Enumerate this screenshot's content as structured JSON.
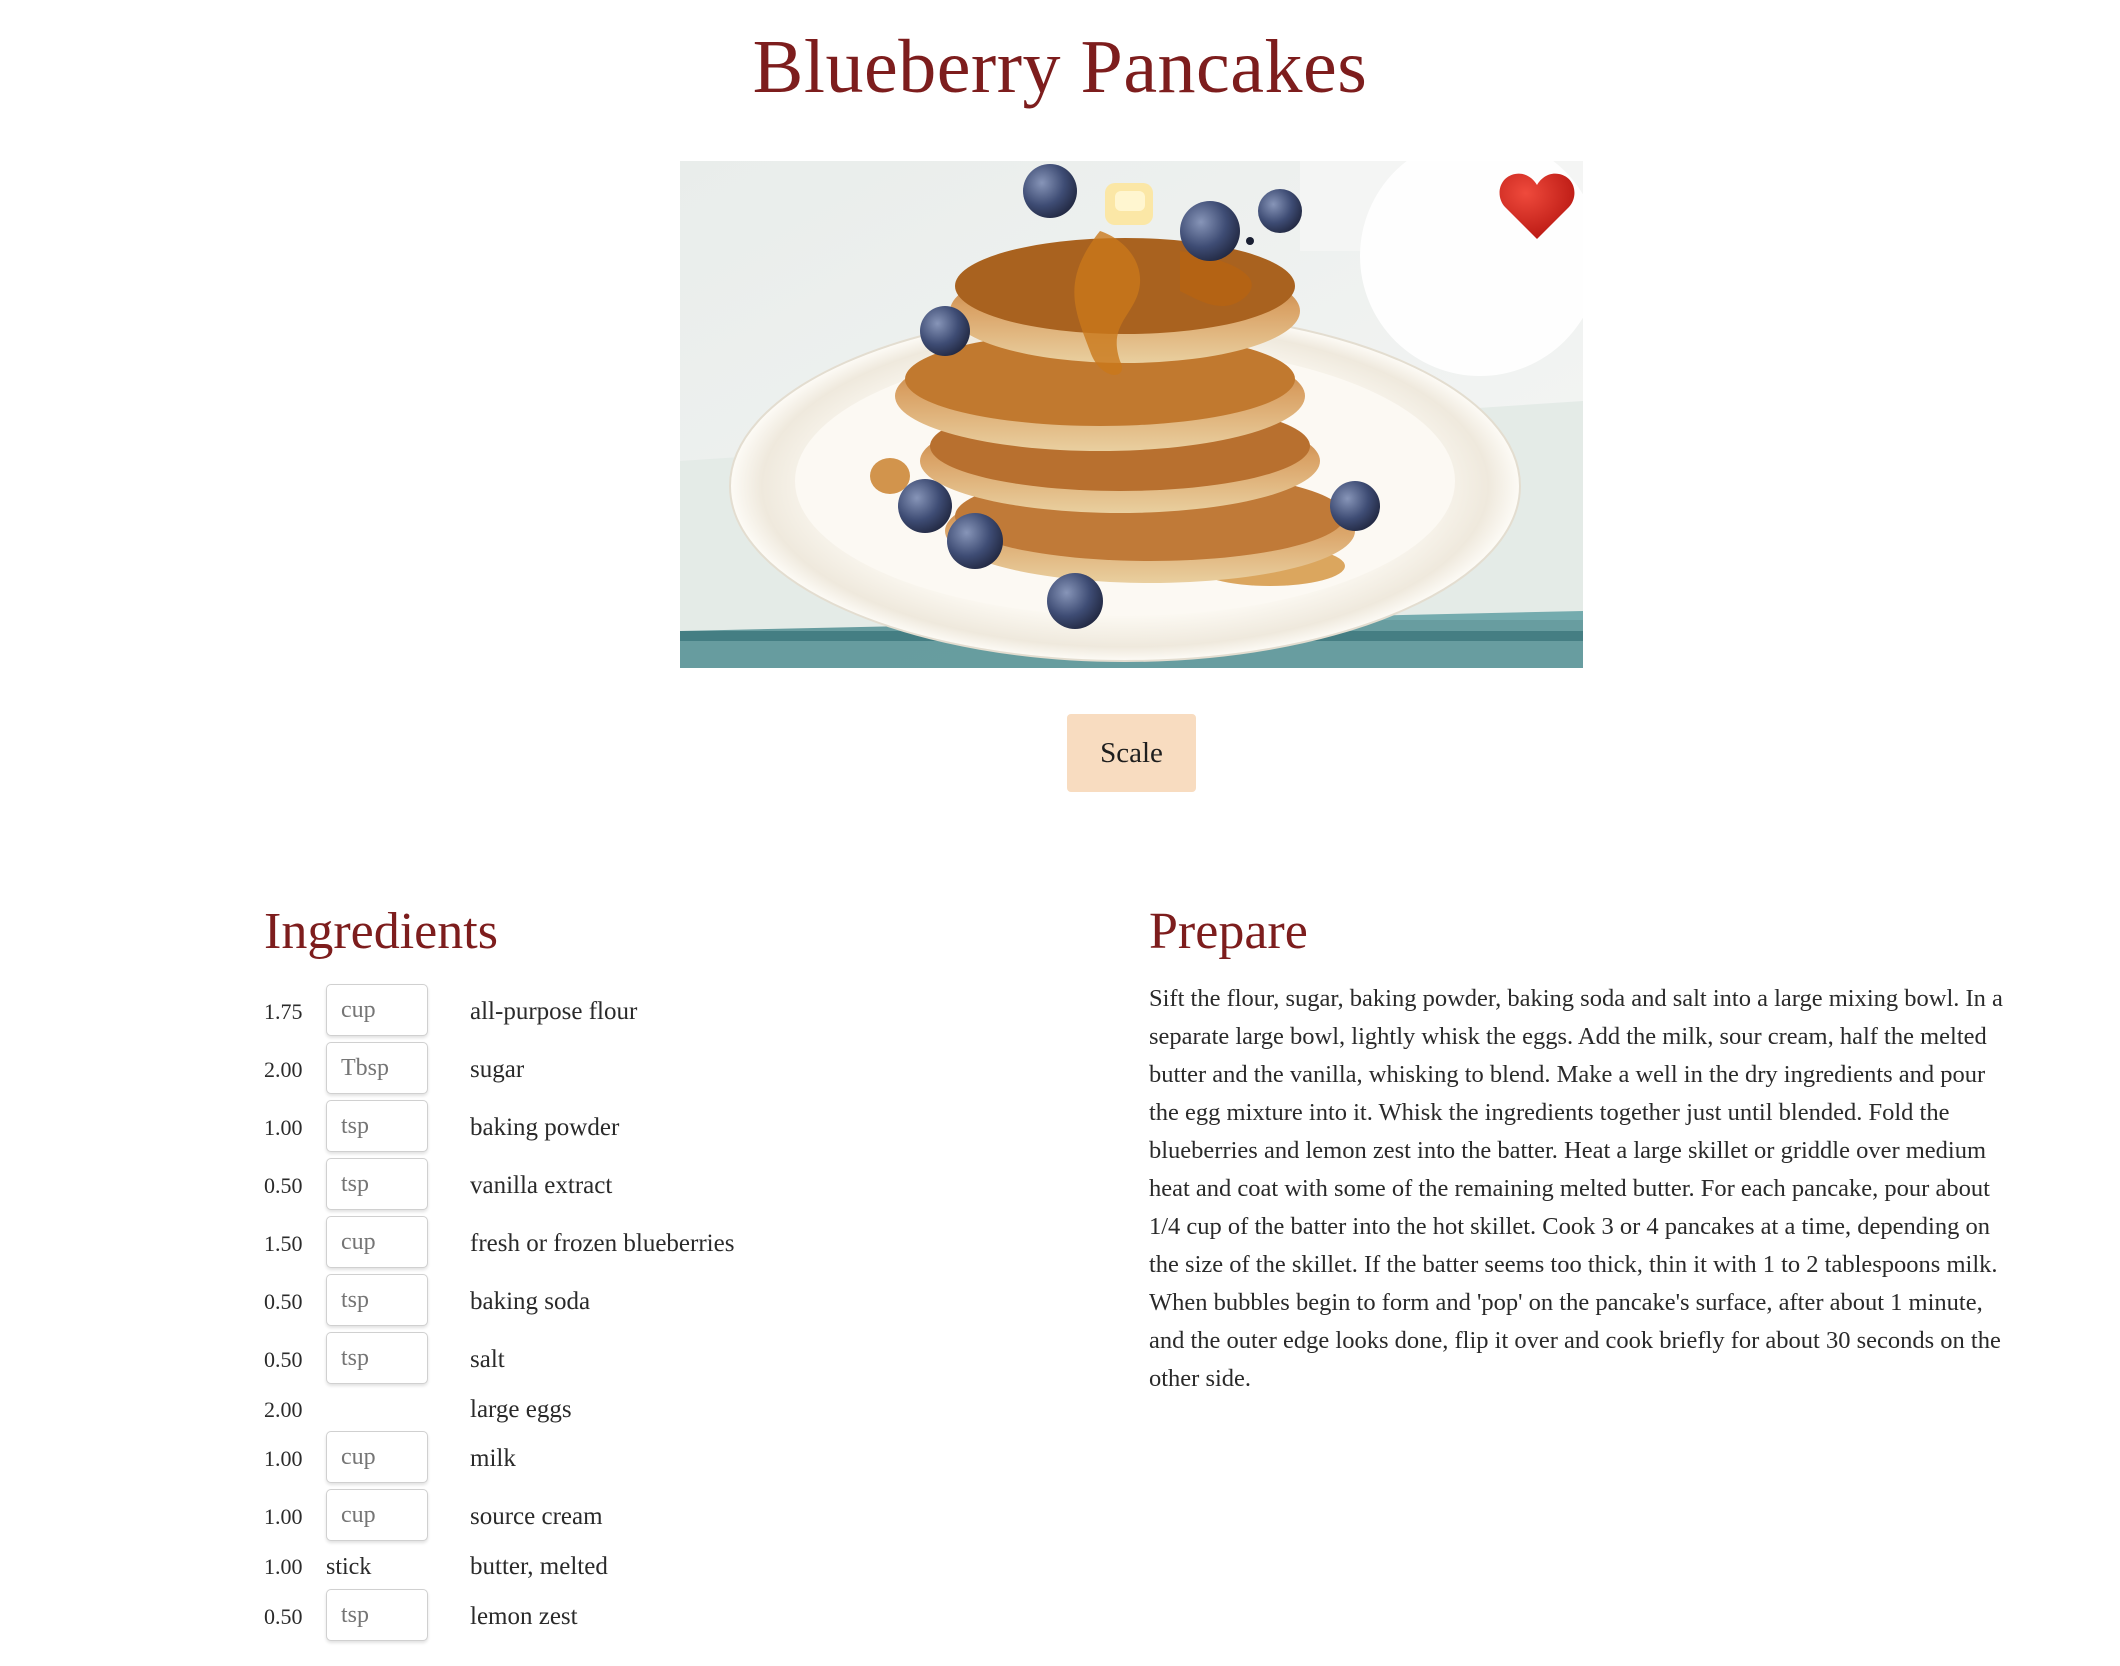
{
  "recipe": {
    "title": "Blueberry Pancakes",
    "scale_label": "Scale",
    "ingredients_heading": "Ingredients",
    "prepare_heading": "Prepare",
    "ingredients": [
      {
        "qty": "1.75",
        "unit": "cup",
        "unit_editable": true,
        "name": "all-purpose flour"
      },
      {
        "qty": "2.00",
        "unit": "Tbsp",
        "unit_editable": true,
        "name": "sugar"
      },
      {
        "qty": "1.00",
        "unit": "tsp",
        "unit_editable": true,
        "name": "baking powder"
      },
      {
        "qty": "0.50",
        "unit": "tsp",
        "unit_editable": true,
        "name": "vanilla extract"
      },
      {
        "qty": "1.50",
        "unit": "cup",
        "unit_editable": true,
        "name": "fresh or frozen blueberries"
      },
      {
        "qty": "0.50",
        "unit": "tsp",
        "unit_editable": true,
        "name": "baking soda"
      },
      {
        "qty": "0.50",
        "unit": "tsp",
        "unit_editable": true,
        "name": "salt"
      },
      {
        "qty": "2.00",
        "unit": "",
        "unit_editable": false,
        "name": "large eggs"
      },
      {
        "qty": "1.00",
        "unit": "cup",
        "unit_editable": true,
        "name": "milk"
      },
      {
        "qty": "1.00",
        "unit": "cup",
        "unit_editable": true,
        "name": "source cream"
      },
      {
        "qty": "1.00",
        "unit": "stick",
        "unit_editable": false,
        "name": "butter, melted"
      },
      {
        "qty": "0.50",
        "unit": "tsp",
        "unit_editable": true,
        "name": "lemon zest"
      }
    ],
    "instructions": "Sift the flour, sugar, baking powder, baking soda and salt into a large mixing bowl. In a separate large bowl, lightly whisk the eggs. Add the milk, sour cream, half the melted butter and the vanilla, whisking to blend. Make a well in the dry ingredients and pour the egg mixture into it. Whisk the ingredients together just until blended. Fold the blueberries and lemon zest into the batter. Heat a large skillet or griddle over medium heat and coat with some of the remaining melted butter. For each pancake, pour about 1/4 cup of the batter into the hot skillet. Cook 3 or 4 pancakes at a time, depending on the size of the skillet. If the batter seems too thick, thin it with 1 to 2 tablespoons milk. When bubbles begin to form and 'pop' on the pancake's surface, after about 1 minute, and the outer edge looks done, flip it over and cook briefly for about 30 seconds on the other side."
  },
  "icons": {
    "favorite": "heart-icon"
  },
  "colors": {
    "title": "#7d1d1d",
    "scale_button": "#f8dcc0",
    "heart": "#d4201e"
  }
}
